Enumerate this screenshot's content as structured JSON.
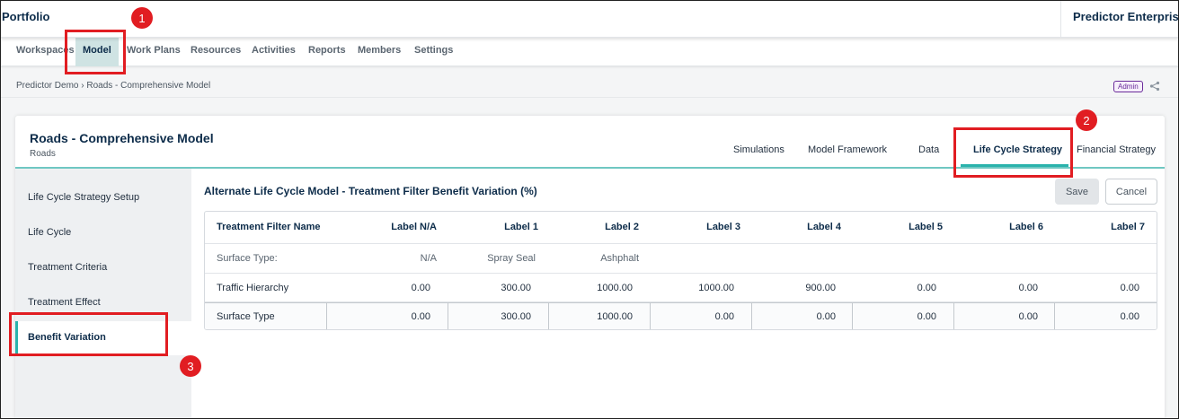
{
  "app": {
    "title": "Portfolio",
    "org": "Predictor Enterprise"
  },
  "nav": {
    "items": [
      {
        "label": "Workspaces"
      },
      {
        "label": "Model",
        "active": true
      },
      {
        "label": "Work Plans"
      },
      {
        "label": "Resources"
      },
      {
        "label": "Activities"
      },
      {
        "label": "Reports"
      },
      {
        "label": "Members"
      },
      {
        "label": "Settings"
      }
    ]
  },
  "breadcrumb": "Predictor Demo › Roads - Comprehensive Model",
  "role_badge": "Admin",
  "share_icon": "share-icon",
  "model": {
    "title": "Roads - Comprehensive Model",
    "subtitle": "Roads",
    "tabs": [
      {
        "label": "Simulations"
      },
      {
        "label": "Model Framework"
      },
      {
        "label": "Data"
      },
      {
        "label": "Life Cycle Strategy",
        "active": true
      },
      {
        "label": "Financial Strategy"
      }
    ]
  },
  "sidebar": {
    "items": [
      {
        "label": "Life Cycle Strategy Setup"
      },
      {
        "label": "Life Cycle"
      },
      {
        "label": "Treatment Criteria"
      },
      {
        "label": "Treatment Effect"
      },
      {
        "label": "Benefit Variation",
        "active": true
      }
    ]
  },
  "section": {
    "title": "Alternate Life Cycle Model - Treatment Filter Benefit Variation (%)",
    "save_label": "Save",
    "cancel_label": "Cancel"
  },
  "table": {
    "headers": [
      "Treatment Filter Name",
      "Label N/A",
      "Label 1",
      "Label 2",
      "Label 3",
      "Label 4",
      "Label 5",
      "Label 6",
      "Label 7"
    ],
    "subheader": {
      "name": "Surface Type:",
      "values": [
        "N/A",
        "Spray Seal",
        "Ashphalt"
      ]
    },
    "rows": [
      {
        "name": "Traffic Hierarchy",
        "values": [
          "0.00",
          "300.00",
          "1000.00",
          "1000.00",
          "900.00",
          "0.00",
          "0.00",
          "0.00"
        ]
      },
      {
        "name": "Surface Type",
        "values": [
          "0.00",
          "300.00",
          "1000.00",
          "0.00",
          "0.00",
          "0.00",
          "0.00",
          "0.00"
        ]
      }
    ]
  },
  "annotations": [
    "1",
    "2",
    "3"
  ],
  "colors": {
    "accent": "#2ab3ac",
    "highlight": "#e11d22",
    "navy": "#0d2c4a",
    "badge": "#6a2b9a"
  }
}
